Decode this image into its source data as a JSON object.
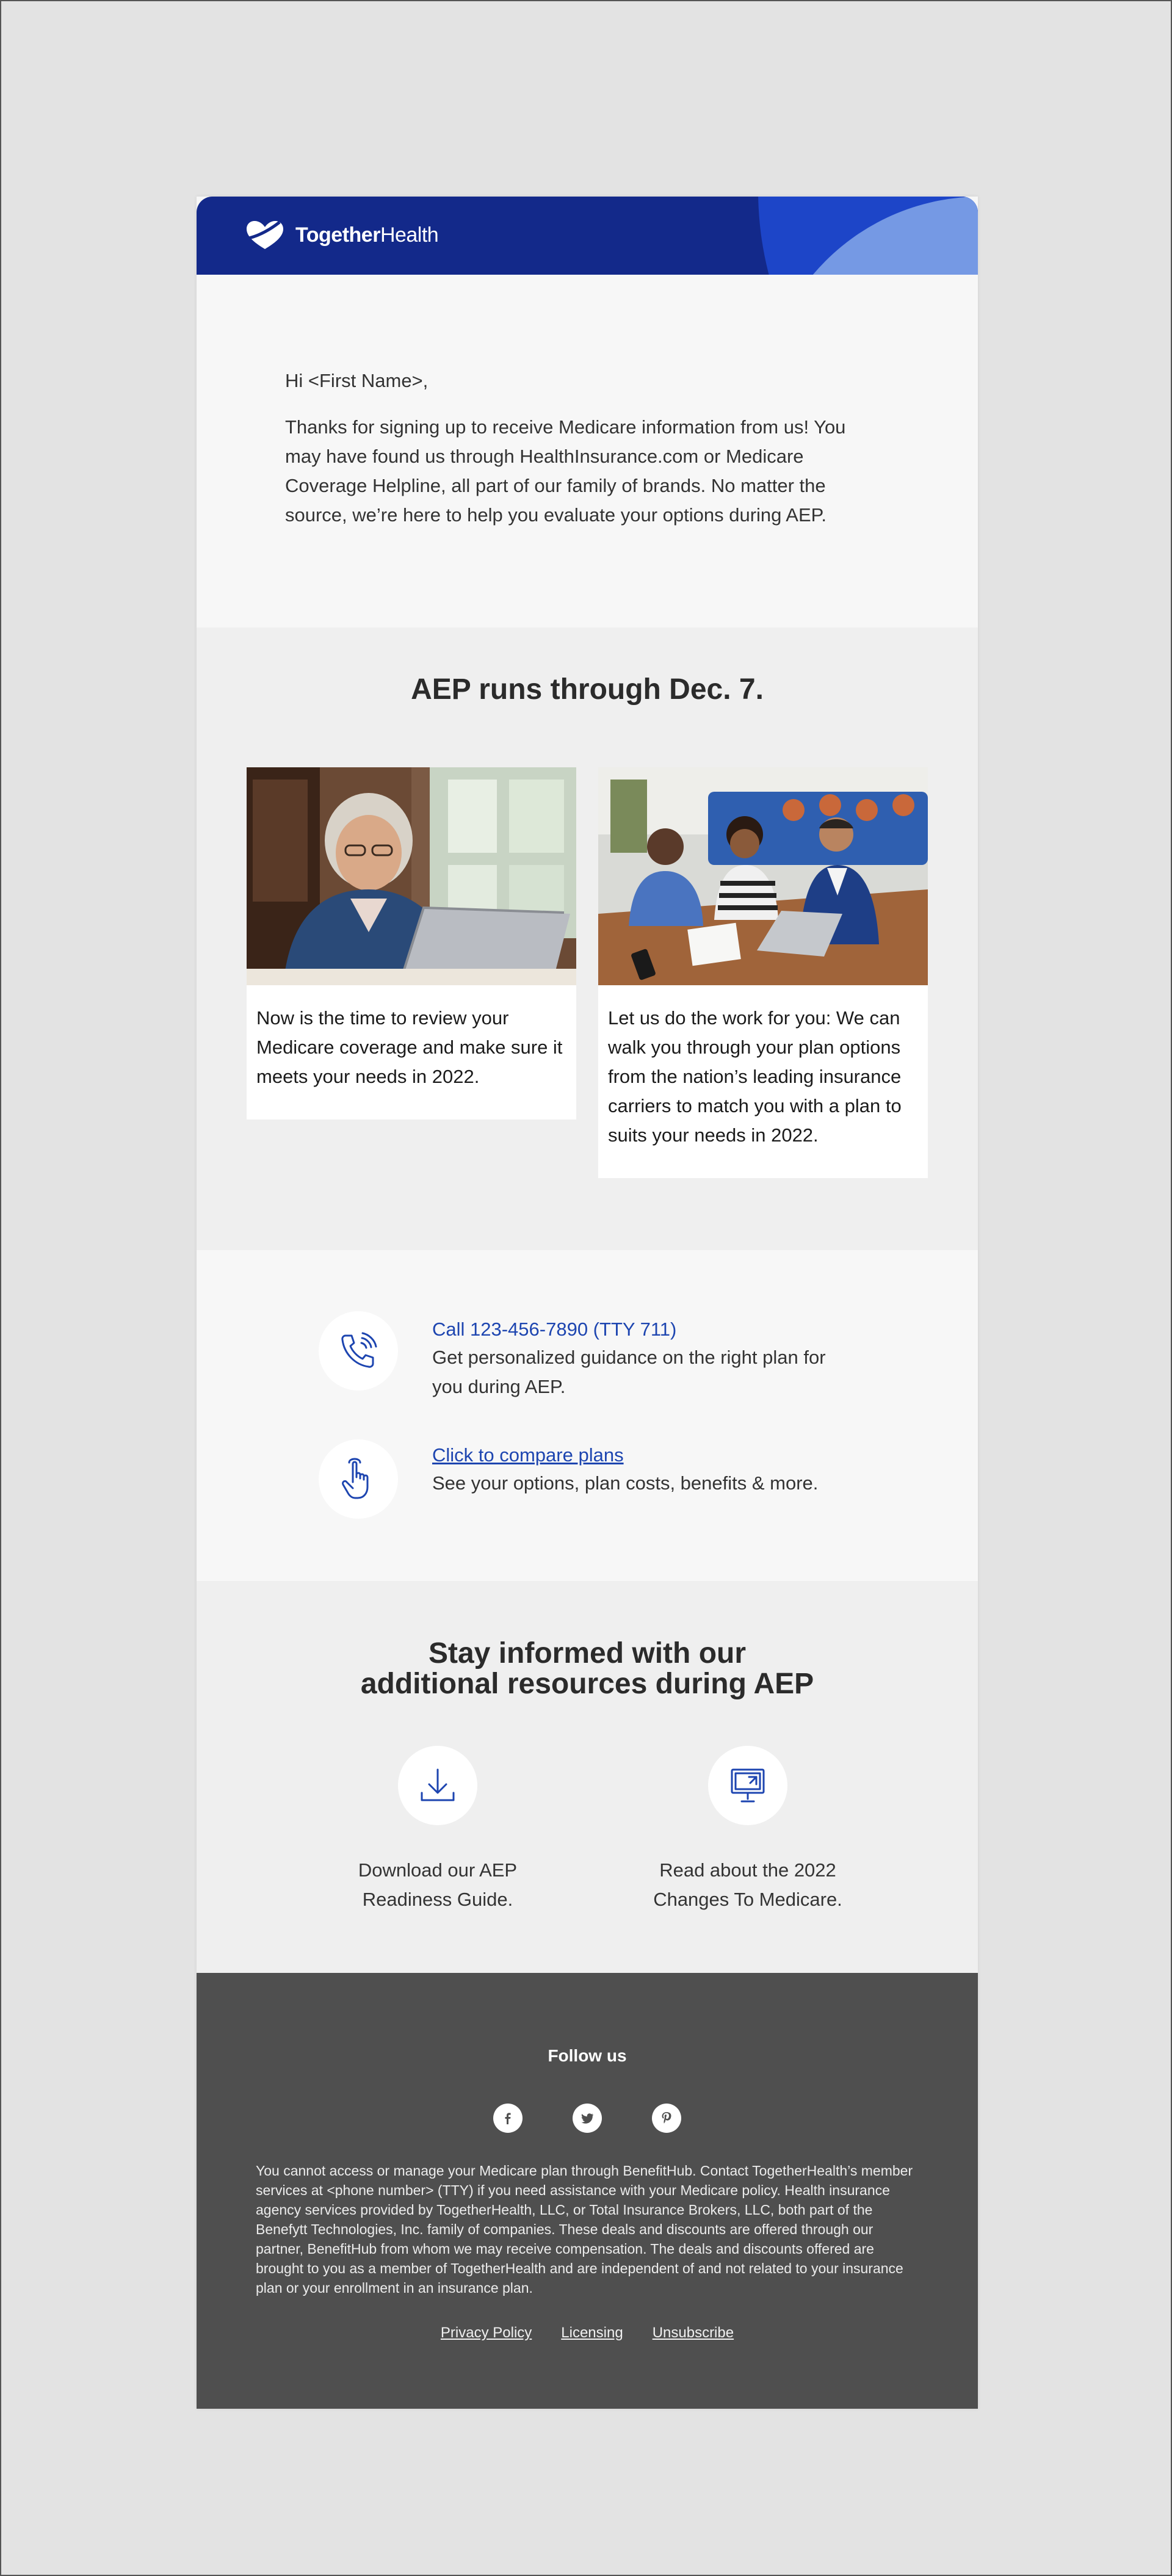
{
  "brand": {
    "name_bold": "Together",
    "name_regular": "Health",
    "colors": {
      "header": "#13298a",
      "accent_blue": "#1d45b0",
      "light_blue": "#7599e4",
      "footer": "#4f4f4f"
    }
  },
  "intro": {
    "greeting": "Hi <First Name>,",
    "body": "Thanks for signing up to receive Medicare information from us! You may have found us through HealthInsurance.com or Medicare Coverage Helpline, all part of our family of brands. No matter the source, we’re here to help you evaluate your options during AEP."
  },
  "aep": {
    "heading": "AEP runs through Dec. 7.",
    "cards": [
      {
        "image": "senior-woman-laptop-photo",
        "text": "Now is the time to review your Medicare coverage and make sure it meets your needs in 2022."
      },
      {
        "image": "couple-with-advisor-photo",
        "text": "Let us do the work for you: We can walk you through your plan options from the nation’s leading insurance carriers to match you with a plan to suits your needs in 2022."
      }
    ]
  },
  "contact": {
    "call": {
      "icon": "phone-icon",
      "link": "Call 123-456-7890 (TTY 711)",
      "desc": "Get personalized guidance on the right plan for you during AEP."
    },
    "compare": {
      "icon": "pointer-hand-icon",
      "link": "Click to compare plans",
      "desc": "See your options, plan costs, benefits & more."
    }
  },
  "resources": {
    "heading_line1": "Stay informed with our",
    "heading_line2": "additional resources during AEP",
    "items": [
      {
        "icon": "download-icon",
        "line1": "Download our AEP",
        "line2": "Readiness Guide."
      },
      {
        "icon": "monitor-icon",
        "line1": "Read about the 2022",
        "line2": "Changes To Medicare."
      }
    ]
  },
  "footer": {
    "follow": "Follow us",
    "socials": [
      "facebook-icon",
      "twitter-icon",
      "pinterest-icon"
    ],
    "disclaimer": "You cannot access or manage your Medicare plan through BenefitHub.  Contact TogetherHealth’s member services at <phone number> (TTY) if you need assistance with your Medicare policy. Health insurance agency services provided by TogetherHealth, LLC, or Total Insurance Brokers, LLC, both part of the Benefytt Technologies, Inc. family of companies. These deals and discounts are offered through our partner, BenefitHub from whom we may receive compensation. The deals and discounts offered are brought to you as a member of TogetherHealth and are independent of and not related to your insurance plan or your enrollment in an insurance plan.",
    "links": [
      "Privacy Policy",
      "Licensing",
      "Unsubscribe"
    ]
  }
}
